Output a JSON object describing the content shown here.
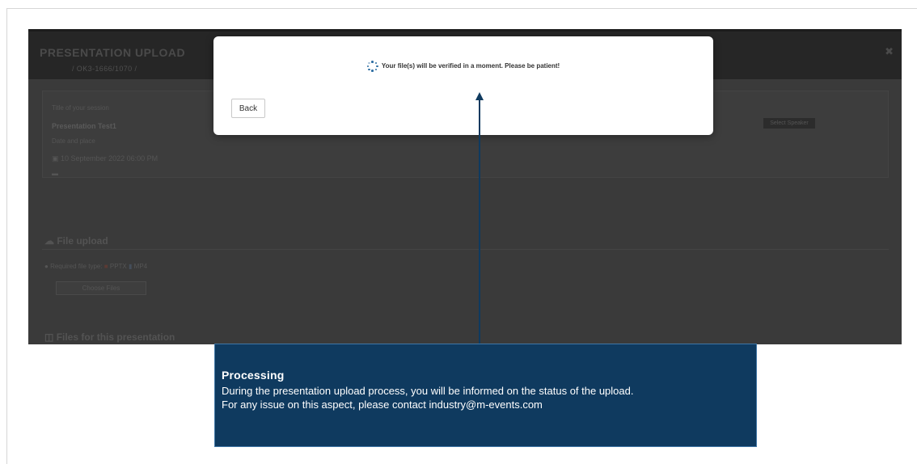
{
  "app": {
    "title": "PRESENTATION UPLOAD",
    "code": "/ OK3-1666/1070 /",
    "close_icon": "close-icon",
    "details": {
      "label": "Title of your session",
      "title": "Presentation Test1",
      "subtitle": "Date and place",
      "date": "10 September 2022 06:00 PM",
      "mark": "▬",
      "badge": "Select Speaker"
    },
    "file_upload": {
      "title": "File upload",
      "types_label": "Required file type:",
      "type_pptx": "PPTX",
      "type_mp4": "MP4",
      "choose_label": "Choose Files"
    },
    "files_title": "Files for this presentation"
  },
  "modal": {
    "message": "Your file(s) will be verified in a moment. Please be patient!",
    "back_label": "Back",
    "spinner_icon": "spinner-icon"
  },
  "callout": {
    "title": "Processing",
    "line1": "During the presentation upload process, you will be informed on the status of the upload.",
    "line2": "For any issue on this aspect, please contact industry@m-events.com",
    "background": "#0f3a5f"
  }
}
